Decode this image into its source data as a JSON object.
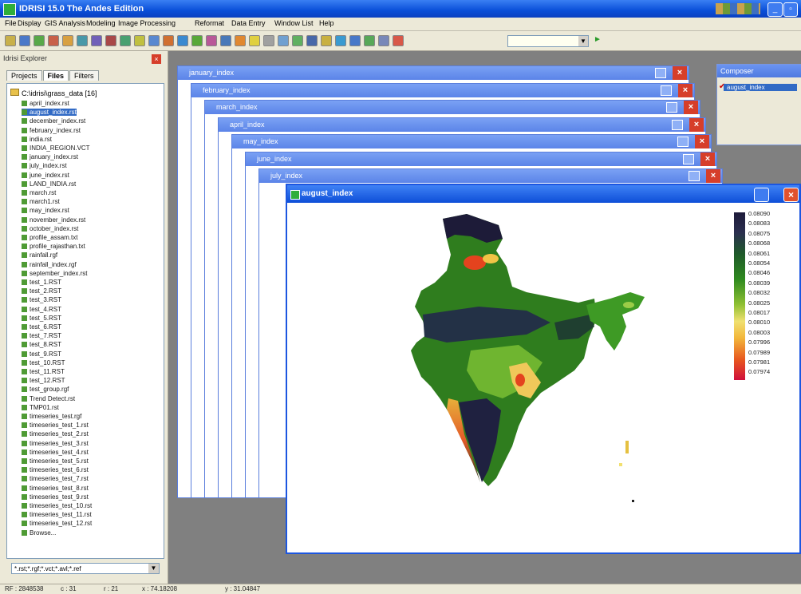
{
  "app": {
    "title": "IDRISI 15.0   The Andes Edition"
  },
  "menu": [
    "File",
    "Display",
    "GIS Analysis",
    "Modeling",
    "Image Processing",
    "Reformat",
    "Data Entry",
    "Window List",
    "Help"
  ],
  "explorer": {
    "header": "Idrisi Explorer",
    "tabs": [
      "Projects",
      "Files",
      "Filters"
    ],
    "active_tab": "Files",
    "folder": "C:\\idrisi\\grass_data [16]",
    "files": [
      "april_index.rst",
      "august_index.rst",
      "december_index.rst",
      "february_index.rst",
      "india.rst",
      "INDIA_REGION.VCT",
      "january_index.rst",
      "july_index.rst",
      "june_index.rst",
      "LAND_INDIA.rst",
      "march.rst",
      "march1.rst",
      "may_index.rst",
      "november_index.rst",
      "october_index.rst",
      "profile_assam.txt",
      "profile_rajasthan.txt",
      "rainfall.rgf",
      "rainfall_index.rgf",
      "september_index.rst",
      "test_1.RST",
      "test_2.RST",
      "test_3.RST",
      "test_4.RST",
      "test_5.RST",
      "test_6.RST",
      "test_7.RST",
      "test_8.RST",
      "test_9.RST",
      "test_10.RST",
      "test_11.RST",
      "test_12.RST",
      "test_group.rgf",
      "Trend Detect.rst",
      "TMP01.rst",
      "timeseries_test.rgf",
      "timeseries_test_1.rst",
      "timeseries_test_2.rst",
      "timeseries_test_3.rst",
      "timeseries_test_4.rst",
      "timeseries_test_5.rst",
      "timeseries_test_6.rst",
      "timeseries_test_7.rst",
      "timeseries_test_8.rst",
      "timeseries_test_9.rst",
      "timeseries_test_10.rst",
      "timeseries_test_11.rst",
      "timeseries_test_12.rst",
      "Browse..."
    ],
    "selected_index": 1,
    "filter_value": "*.rst;*.rgf;*.vct;*.avl;*.ref"
  },
  "composer": {
    "title": "Composer",
    "item": "august_index"
  },
  "windows": [
    {
      "title": "january_index"
    },
    {
      "title": "february_index"
    },
    {
      "title": "march_index"
    },
    {
      "title": "april_index"
    },
    {
      "title": "may_index"
    },
    {
      "title": "june_index"
    },
    {
      "title": "july_index"
    }
  ],
  "main_window": {
    "title": "august_index"
  },
  "legend": {
    "labels": [
      "0.08090",
      "0.08083",
      "0.08075",
      "0.08068",
      "0.08061",
      "0.08054",
      "0.08046",
      "0.08039",
      "0.08032",
      "0.08025",
      "0.08017",
      "0.08010",
      "0.08003",
      "0.07996",
      "0.07989",
      "0.07981",
      "0.07974"
    ]
  },
  "status": {
    "rf": "RF : 2848538",
    "col": "c : 31",
    "row": "r : 21",
    "x": "x : 74.18208",
    "y": "y : 31.04847"
  },
  "colors": {
    "titlebar": "#0a4fd8",
    "window_chrome": "#5b84e8",
    "close": "#d63e2a",
    "selection": "#316ac5"
  }
}
